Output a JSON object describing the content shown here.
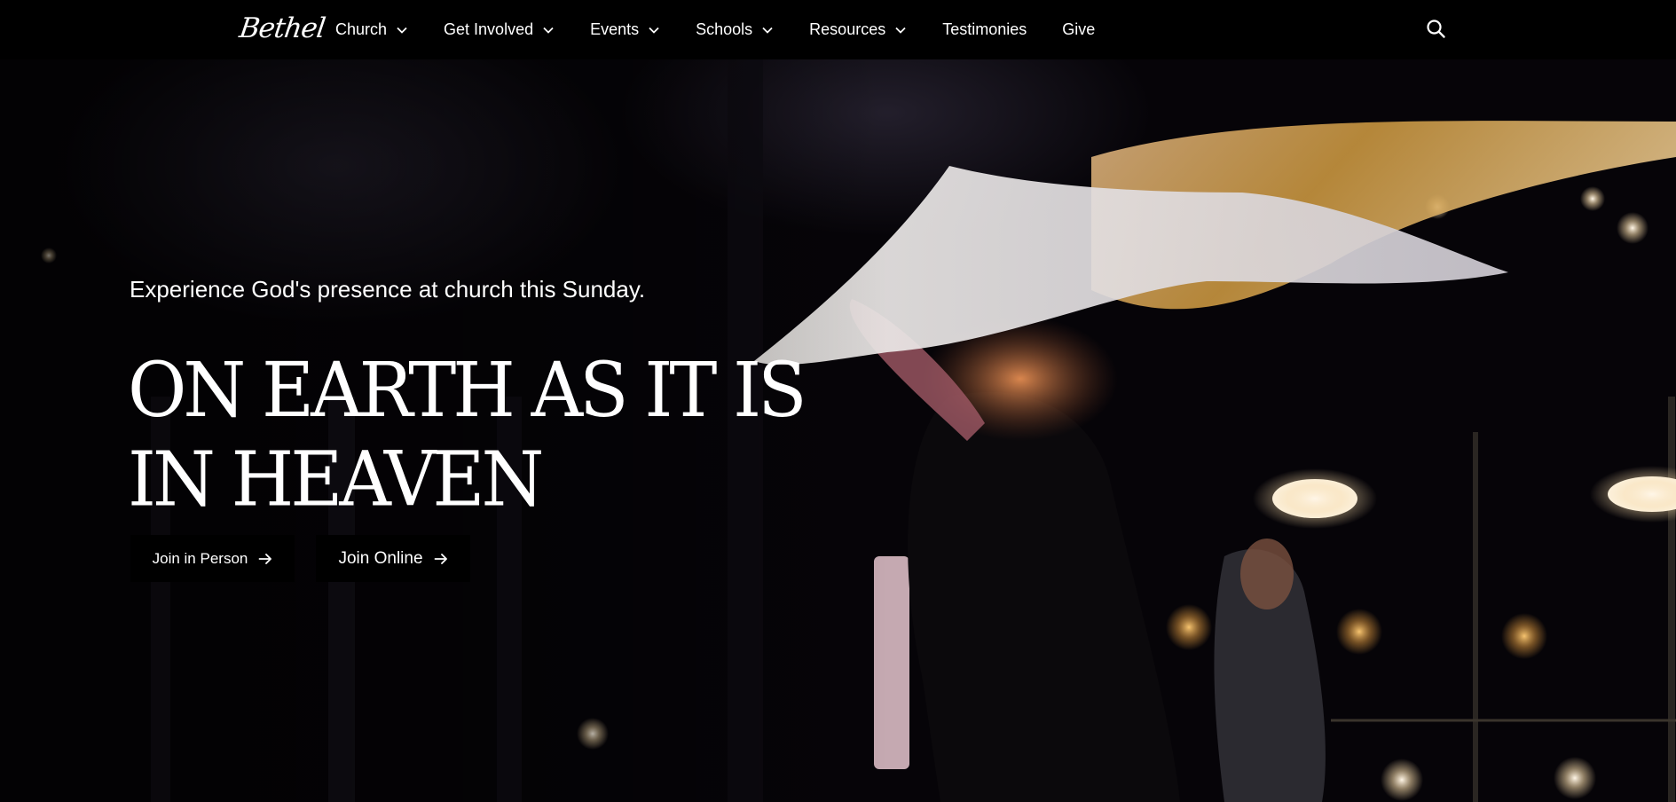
{
  "nav": {
    "logo": "Bethel",
    "items": [
      {
        "label": "Church",
        "dropdown": true
      },
      {
        "label": "Get Involved",
        "dropdown": true
      },
      {
        "label": "Events",
        "dropdown": true
      },
      {
        "label": "Schools",
        "dropdown": true
      },
      {
        "label": "Resources",
        "dropdown": true
      },
      {
        "label": "Testimonies",
        "dropdown": false
      },
      {
        "label": "Give",
        "dropdown": false
      }
    ],
    "search_icon": "search-icon"
  },
  "hero": {
    "tagline": "Experience God's presence at church this Sunday.",
    "headline_line1": "ON EARTH AS IT IS",
    "headline_line2": "IN HEAVEN",
    "buttons": [
      {
        "label": "Join in Person",
        "icon": "arrow-right-icon"
      },
      {
        "label": "Join Online",
        "icon": "arrow-right-icon"
      }
    ]
  },
  "colors": {
    "nav_background": "#000000",
    "button_background": "#000000",
    "text": "#ffffff"
  }
}
